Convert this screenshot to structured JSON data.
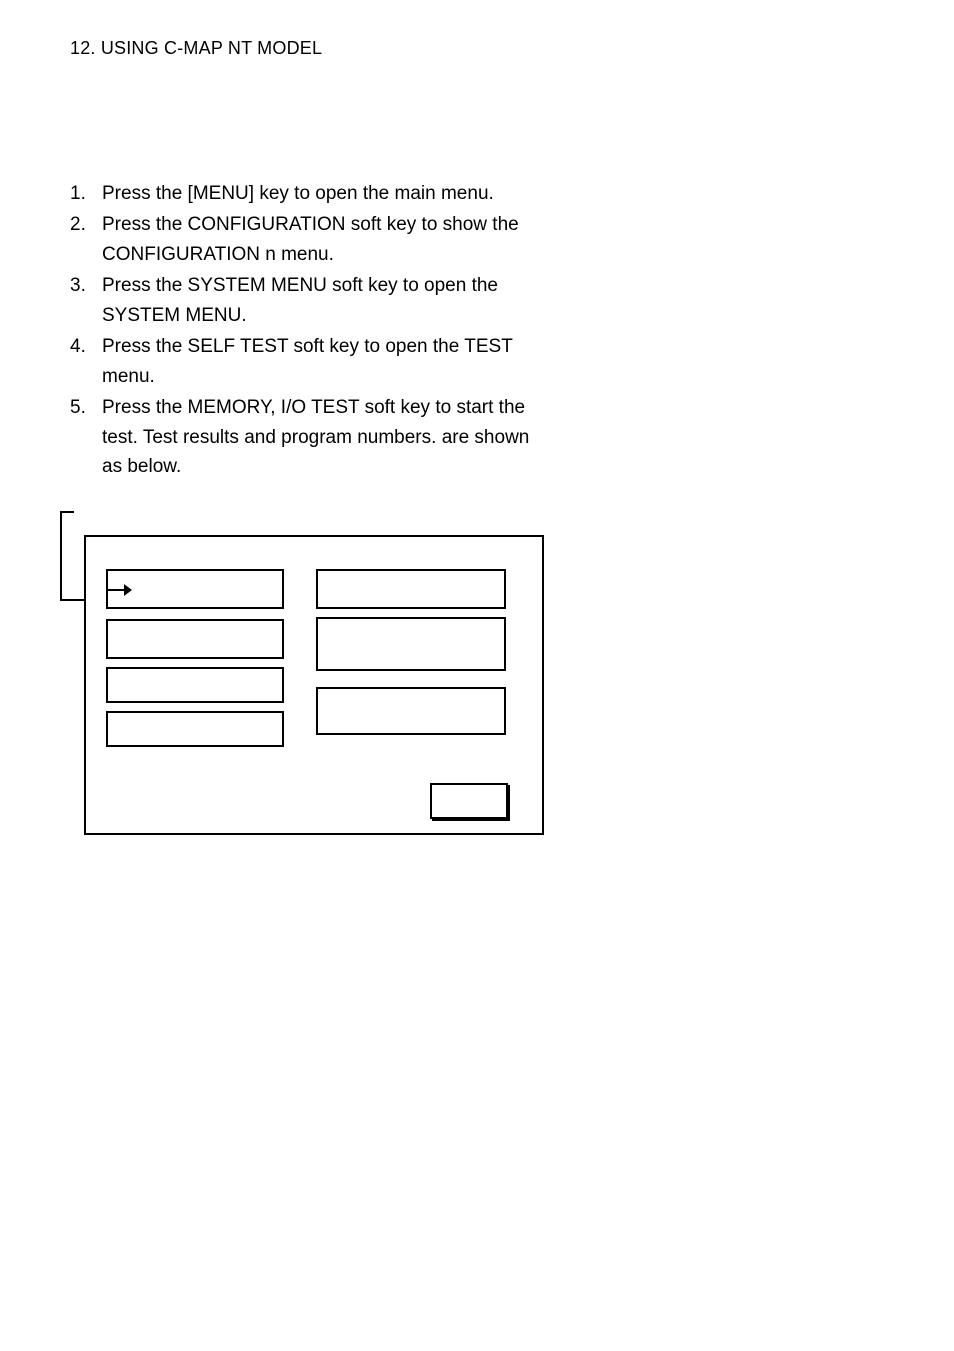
{
  "header": "12. USING C-MAP NT MODEL",
  "steps": [
    {
      "num": "1.",
      "text": "Press the [MENU] key to open the main menu."
    },
    {
      "num": "2.",
      "text": "Press the CONFIGURATION soft key to show the CONFIGURATION n menu."
    },
    {
      "num": "3.",
      "text": "Press the SYSTEM MENU soft key to open the SYSTEM MENU."
    },
    {
      "num": "4.",
      "text": "Press the SELF TEST soft key to open the TEST menu."
    },
    {
      "num": "5.",
      "text": "Press the MEMORY, I/O TEST soft key to start the test. Test results and program numbers. are shown as below."
    }
  ]
}
